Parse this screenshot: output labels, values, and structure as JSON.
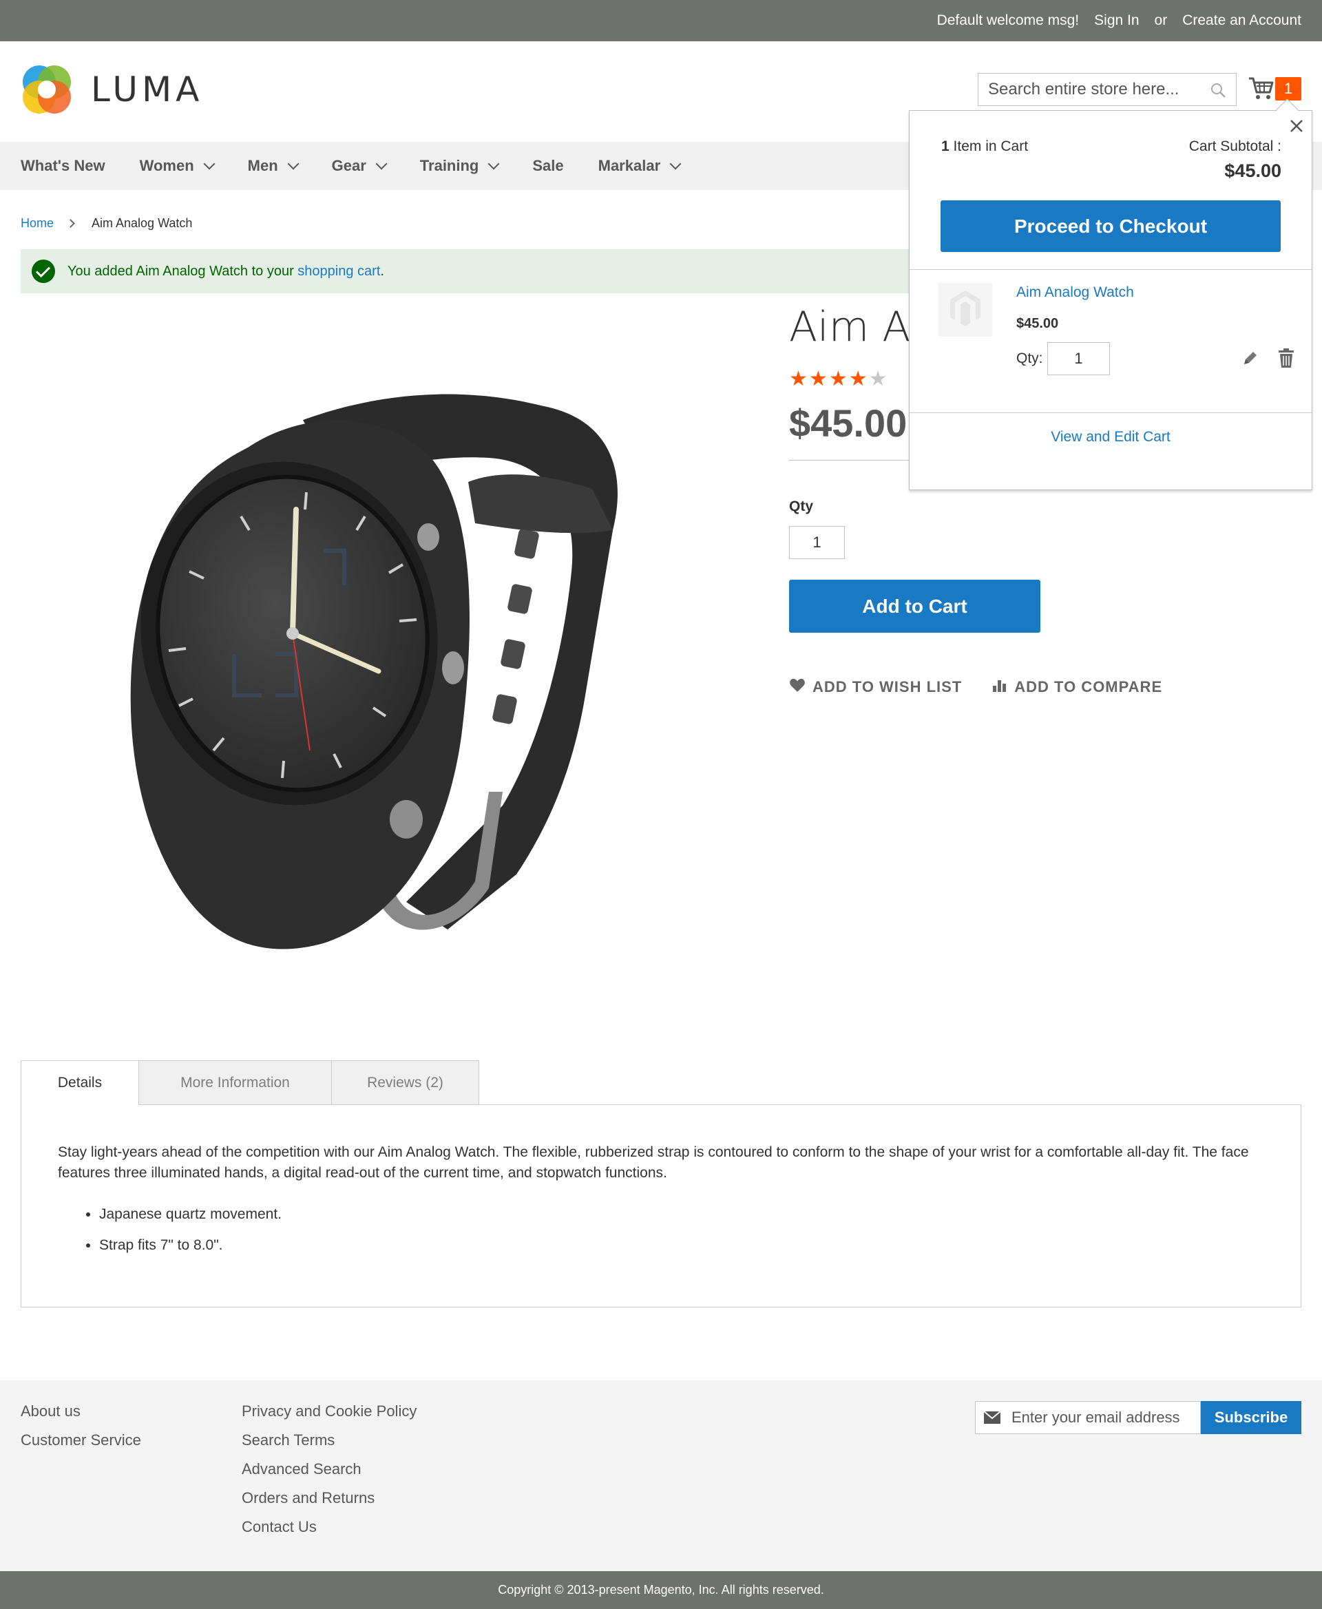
{
  "header": {
    "welcome": "Default welcome msg!",
    "sign_in": "Sign In",
    "or": "or",
    "create_account": "Create an Account",
    "logo_text": "LUMA",
    "search_placeholder": "Search entire store here...",
    "cart_count": "1"
  },
  "nav": {
    "items": [
      {
        "label": "What's New"
      },
      {
        "label": "Women"
      },
      {
        "label": "Men"
      },
      {
        "label": "Gear"
      },
      {
        "label": "Training"
      },
      {
        "label": "Sale"
      },
      {
        "label": "Markalar"
      }
    ]
  },
  "breadcrumb": {
    "home": "Home",
    "current": "Aim Analog Watch"
  },
  "message": {
    "text_before": "You added Aim Analog Watch to your ",
    "link": "shopping cart",
    "text_after": "."
  },
  "product": {
    "title": "Aim Analog Watch",
    "rating_stars": 4,
    "rating_max": 5,
    "price": "$45.00",
    "qty_label": "Qty",
    "qty_value": "1",
    "add_to_cart": "Add to Cart",
    "wishlist": "ADD TO WISH LIST",
    "compare": "ADD TO COMPARE"
  },
  "minicart": {
    "count_num": "1",
    "count_text": " Item in Cart",
    "subtotal_label": "Cart Subtotal :",
    "subtotal": "$45.00",
    "checkout": "Proceed to Checkout",
    "item_name": "Aim Analog Watch",
    "item_price": "$45.00",
    "qty_label": "Qty:",
    "qty_value": "1",
    "view_edit": "View and Edit Cart"
  },
  "tabs": {
    "details": "Details",
    "more_info": "More Information",
    "reviews": "Reviews (2)",
    "description": "Stay light-years ahead of the competition with our Aim Analog Watch. The flexible, rubberized strap is contoured to conform to the shape of your wrist for a comfortable all-day fit. The face features three illuminated hands, a digital read-out of the current time, and stopwatch functions.",
    "bullets": [
      "Japanese quartz movement.",
      "Strap fits 7\" to 8.0\"."
    ]
  },
  "footer": {
    "col1": [
      "About us",
      "Customer Service"
    ],
    "col2": [
      "Privacy and Cookie Policy",
      "Search Terms",
      "Advanced Search",
      "Orders and Returns",
      "Contact Us"
    ],
    "newsletter_placeholder": "Enter your email address",
    "subscribe": "Subscribe",
    "copyright": "Copyright © 2013-present Magento, Inc. All rights reserved."
  },
  "colors": {
    "accent": "#1979c3",
    "orange": "#ff5501",
    "topbar": "#6e716e",
    "success_bg": "#e5efe5",
    "success_text": "#006400"
  }
}
